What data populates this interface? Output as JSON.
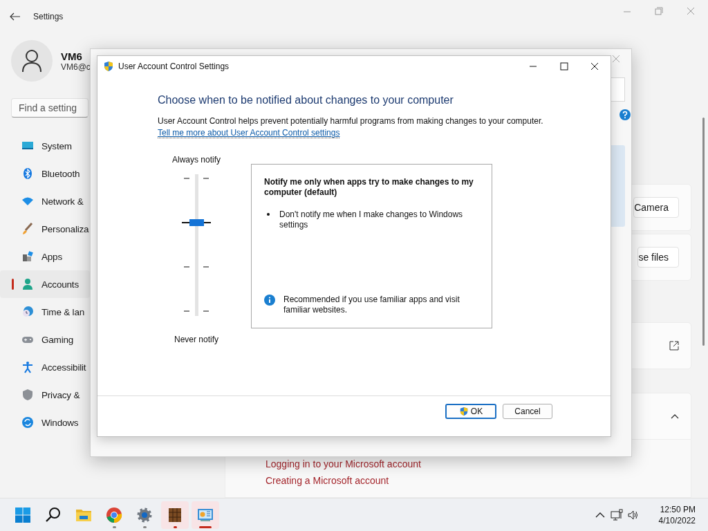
{
  "settings_window": {
    "title": "Settings",
    "user": {
      "name": "VM6",
      "email": "VM6@c"
    },
    "search": {
      "placeholder": "Find a setting"
    },
    "nav": [
      {
        "label": "System",
        "selected": false
      },
      {
        "label": "Bluetooth",
        "selected": false
      },
      {
        "label": "Network &",
        "selected": false
      },
      {
        "label": "Personaliza",
        "selected": false
      },
      {
        "label": "Apps",
        "selected": false
      },
      {
        "label": "Accounts",
        "selected": true
      },
      {
        "label": "Time & lan",
        "selected": false
      },
      {
        "label": "Gaming",
        "selected": false
      },
      {
        "label": "Accessibilit",
        "selected": false
      },
      {
        "label": "Privacy &",
        "selected": false
      },
      {
        "label": "Windows",
        "selected": false
      }
    ],
    "content": {
      "buttons": [
        "Camera",
        "se files"
      ],
      "links": [
        "Logging in to your Microsoft account",
        "Creating a Microsoft account"
      ]
    }
  },
  "uac_dialog": {
    "title": "User Account Control Settings",
    "heading": "Choose when to be notified about changes to your computer",
    "description": "User Account Control helps prevent potentially harmful programs from making changes to your computer.",
    "link": "Tell me more about User Account Control settings",
    "slider": {
      "top_label": "Always notify",
      "bottom_label": "Never notify",
      "level": 0.667
    },
    "info_box": {
      "title": "Notify me only when apps try to make changes to my computer (default)",
      "bullets": [
        "Don't notify me when I make changes to Windows settings"
      ],
      "note": "Recommended if you use familiar apps and visit familiar websites."
    },
    "buttons": [
      {
        "label": "OK",
        "kind": "default"
      },
      {
        "label": "Cancel",
        "kind": "normal"
      }
    ]
  },
  "taskbar": {
    "apps": [
      {
        "kind": "start",
        "running": false,
        "attention": false,
        "selected": false
      },
      {
        "kind": "search",
        "running": false,
        "attention": false,
        "selected": false
      },
      {
        "kind": "folder",
        "running": false,
        "attention": false,
        "selected": false
      },
      {
        "kind": "browser",
        "running": true,
        "attention": false,
        "selected": false
      },
      {
        "kind": "gear",
        "running": true,
        "attention": false,
        "selected": false
      },
      {
        "kind": "crate",
        "running": true,
        "attention": true,
        "selected": false
      },
      {
        "kind": "panel",
        "running": true,
        "attention": false,
        "selected": true
      }
    ],
    "clock": {
      "time": "12:50 PM",
      "date": "4/10/2022"
    }
  }
}
